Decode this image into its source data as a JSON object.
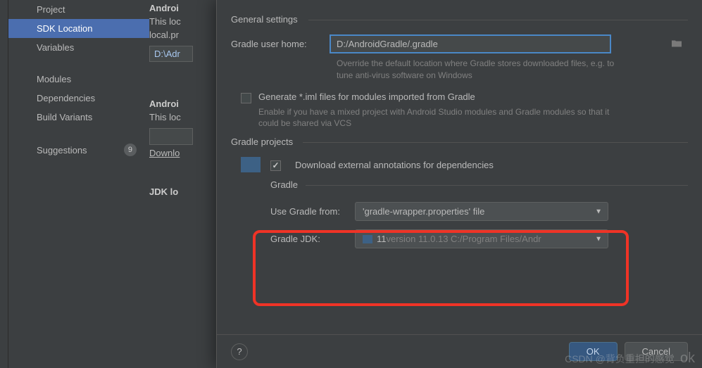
{
  "sidebar": {
    "items": [
      {
        "label": "Project"
      },
      {
        "label": "SDK Location"
      },
      {
        "label": "Variables"
      },
      {
        "label": "Modules"
      },
      {
        "label": "Dependencies"
      },
      {
        "label": "Build Variants"
      },
      {
        "label": "Suggestions",
        "badge": "9"
      }
    ]
  },
  "middle": {
    "androi_trunc": "Androi",
    "this_loc": "This loc",
    "local_pr": "local.pr",
    "path_trunc": "D:\\Adr",
    "androi2": "Androi",
    "this_loc2": "This loc",
    "downlo": "Downlo",
    "jdk_lo": "JDK lo"
  },
  "dialog": {
    "general_title": "General settings",
    "gradle_home_label": "Gradle user home:",
    "gradle_home_value": "D:/AndroidGradle/.gradle",
    "gradle_home_hint": "Override the default location where Gradle stores downloaded files, e.g. to tune anti-virus software on Windows",
    "gen_iml_label": "Generate *.iml files for modules imported from Gradle",
    "gen_iml_hint": "Enable if you have a mixed project with Android Studio modules and Gradle modules so that it could be shared via VCS",
    "projects_title": "Gradle projects",
    "download_ext_label": "Download external annotations for dependencies",
    "gradle_legend": "Gradle",
    "use_gradle_from_label": "Use Gradle from:",
    "use_gradle_from_value": "'gradle-wrapper.properties' file",
    "gradle_jdk_label": "Gradle JDK:",
    "gradle_jdk_ver": "11",
    "gradle_jdk_path": " version 11.0.13 C:/Program Files/Andr",
    "ok": "OK",
    "cancel": "Cancel",
    "help": "?"
  },
  "watermark": {
    "text": "CSDN @背负重担的感觉",
    "ok": "ok"
  }
}
